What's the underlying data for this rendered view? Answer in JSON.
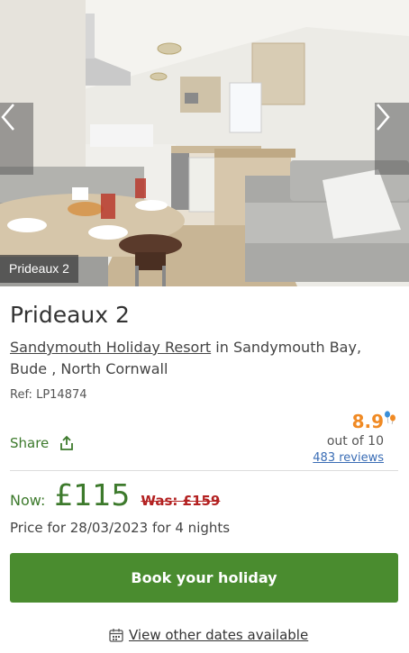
{
  "gallery": {
    "caption": "Prideaux 2",
    "prev_icon": "chevron-left-icon",
    "next_icon": "chevron-right-icon"
  },
  "property": {
    "title": "Prideaux 2",
    "resort_link": "Sandymouth Holiday Resort",
    "location_text": " in Sandymouth Bay, Bude , North Cornwall",
    "ref": "Ref: LP14874"
  },
  "share": {
    "label": "Share",
    "icon": "share-icon"
  },
  "rating": {
    "score": "8.9",
    "out_of": "out of 10",
    "reviews": "483 reviews",
    "score_color": "#f08a24",
    "icon": "balloons-icon"
  },
  "pricing": {
    "now_label": "Now:",
    "price": "£115",
    "was": "Was: £159",
    "note": "Price for 28/03/2023 for 4 nights",
    "accent_color": "#3d7a2c",
    "was_color": "#b32121"
  },
  "actions": {
    "book_label": "Book your holiday",
    "book_color": "#4a8c2f",
    "other_dates_label": "View other dates available",
    "calendar_icon": "calendar-icon"
  }
}
